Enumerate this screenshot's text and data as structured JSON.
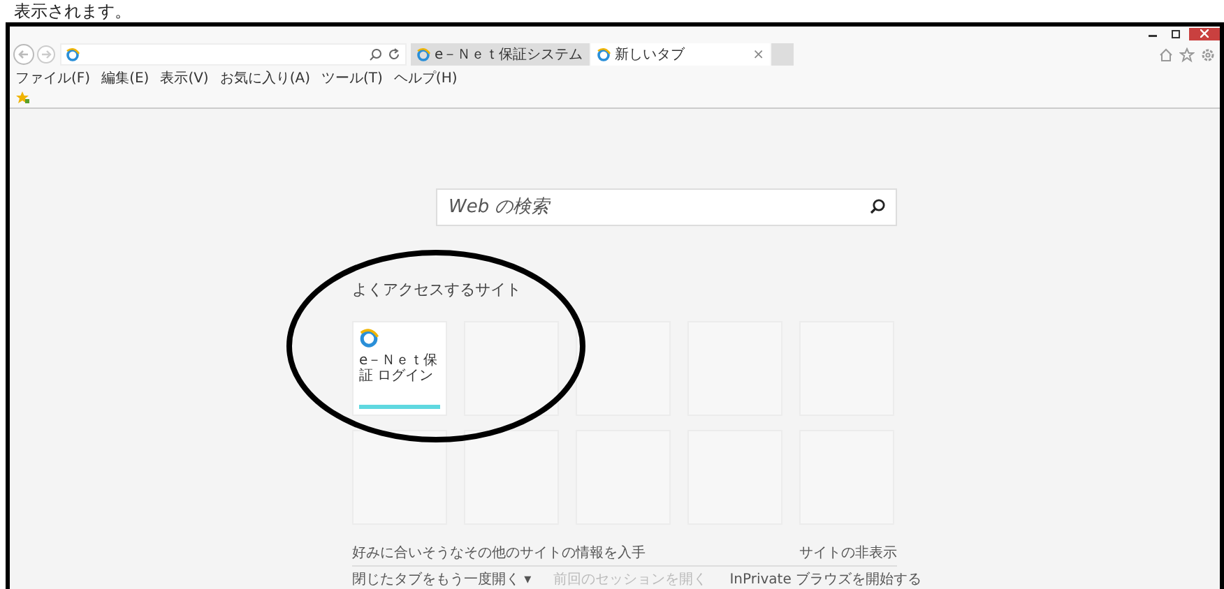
{
  "caption": "表示されます。",
  "tabs": [
    {
      "label": "e－Ｎｅｔ保証システム",
      "selected": false
    },
    {
      "label": "新しいタブ",
      "selected": true,
      "close": "×"
    }
  ],
  "menu": [
    "ファイル(F)",
    "編集(E)",
    "表示(V)",
    "お気に入り(A)",
    "ツール(T)",
    "ヘルプ(H)"
  ],
  "search": {
    "placeholder": "Web の検索"
  },
  "frequent": {
    "heading": "よくアクセスするサイト",
    "tiles": [
      {
        "kind": "site",
        "label": "e－Ｎｅｔ保証 ログイン"
      },
      {
        "kind": "empty"
      },
      {
        "kind": "empty"
      },
      {
        "kind": "empty"
      },
      {
        "kind": "empty"
      },
      {
        "kind": "empty"
      },
      {
        "kind": "empty"
      },
      {
        "kind": "empty"
      },
      {
        "kind": "empty"
      },
      {
        "kind": "empty"
      }
    ]
  },
  "footer": {
    "info": "好みに合いそうなその他のサイトの情報を入手",
    "hide": "サイトの非表示",
    "links": [
      {
        "label": "閉じたタブをもう一度開く ▾",
        "disabled": false
      },
      {
        "label": "前回のセッションを開く",
        "disabled": true
      },
      {
        "label": "InPrivate ブラウズを開始する",
        "disabled": false
      }
    ]
  }
}
